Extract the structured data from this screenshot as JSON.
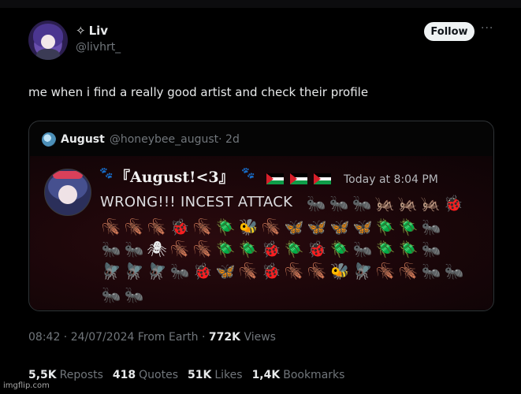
{
  "author": {
    "star": "✧",
    "name": "Liv",
    "handle": "@livhrt_"
  },
  "follow_label": "Follow",
  "more_label": "···",
  "tweet_text": "me when i find a really good artist and check their profile",
  "quote": {
    "name": "August",
    "handle": "@honeybee_august",
    "age": "· 2d",
    "discord": {
      "name": "『August!<3』",
      "time": "Today at 8:04 PM",
      "message": "WRONG!!! INCEST ATTACK",
      "flag_colors": [
        "#000000",
        "#ffffff",
        "#0f9d49",
        "#d81f2a"
      ],
      "emoji_rows": [
        [
          "🐜",
          "🐜",
          "🐜",
          "🦗",
          "🦗",
          "🦗",
          "🐞"
        ],
        [
          "🪳",
          "🪳",
          "🪳",
          "🐞",
          "🪳",
          "🪲",
          "🐝",
          "🪳",
          "🦋",
          "🦋",
          "🦋",
          "🦋",
          "🪲",
          "🪲",
          "🐜"
        ],
        [
          "🐜",
          "🐜",
          "🕷",
          "🪳",
          "🪳",
          "🪲",
          "🪲",
          "🐞",
          "🪲",
          "🐞",
          "🪲",
          "🐜",
          "🪲",
          "🪲",
          "🐜"
        ],
        [
          "🪰",
          "🪰",
          "🪰",
          "🐜",
          "🐞",
          "🦋",
          "🪳",
          "🐞",
          "🪳",
          "🪳",
          "🐝",
          "🪰",
          "🪳",
          "🪳",
          "🐜",
          "🐜"
        ],
        [
          "🐜",
          "🐜"
        ]
      ]
    }
  },
  "meta": {
    "time": "08:42",
    "date": "24/07/2024",
    "source": "From Earth",
    "views_count": "772K",
    "views_label": "Views"
  },
  "stats": {
    "reposts_count": "5,5K",
    "reposts_label": "Reposts",
    "quotes_count": "418",
    "quotes_label": "Quotes",
    "likes_count": "51K",
    "likes_label": "Likes",
    "bookmarks_count": "1,4K",
    "bookmarks_label": "Bookmarks"
  },
  "watermark": "imgflip.com"
}
